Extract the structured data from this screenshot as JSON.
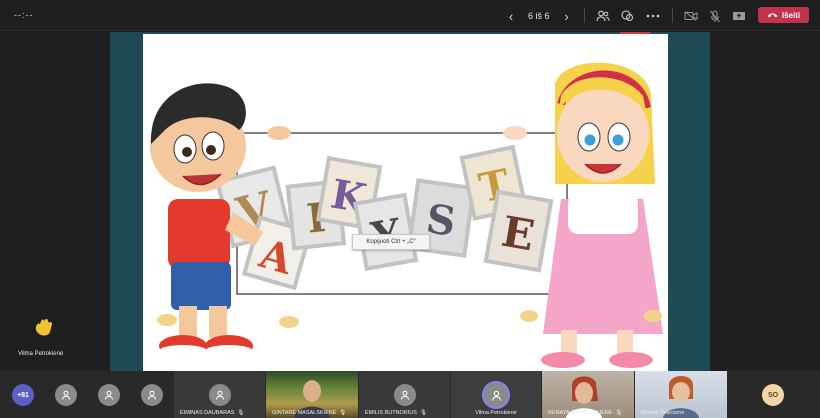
{
  "topbar": {
    "timer": "--:--",
    "slide_counter": "6 iš 6",
    "leave_label": "Išeiti"
  },
  "slide": {
    "title_word": "VAIKYSTĖ",
    "copy_tooltip": "Kopijuoti  Ctrl + „C“"
  },
  "pinned_user": {
    "name": "Vilma Petrokienė"
  },
  "participants": {
    "more_count": "+81",
    "tiles": [
      {
        "name": "EIMINAS DAUBARAS"
      },
      {
        "name": "GINTARĖ MASALSKIENĖ"
      },
      {
        "name": "EMILIS BUTNORIUS"
      },
      {
        "name": "Vilma Petrokienė"
      },
      {
        "name": "RENATA AVANAUSKIENĖ"
      },
      {
        "name": "Rimutė Švarcienė"
      }
    ],
    "so_initials": "SO"
  },
  "colors": {
    "leave": "#c4314b",
    "accent": "#5b5fc7",
    "share_frame": "#1d4a55"
  }
}
